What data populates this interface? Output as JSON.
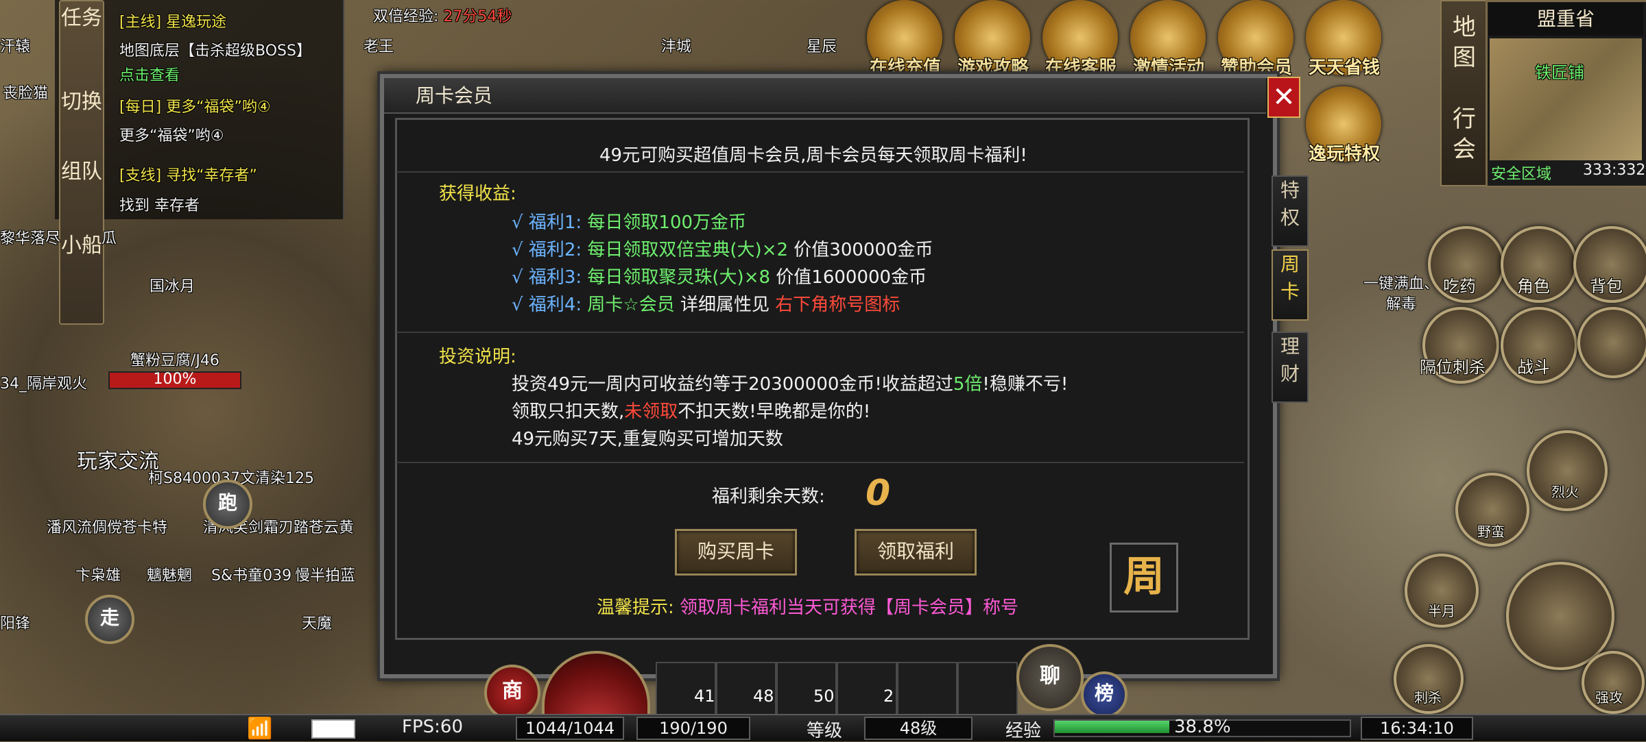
{
  "quest_panel": {
    "side_tabs": [
      "任务",
      "切换",
      "组队",
      "小船"
    ],
    "quests": [
      {
        "tag": "[主线] 星逸玩途",
        "detail": "地图底层【击杀超级BOSS】",
        "link": "点击查看"
      },
      {
        "tag": "[每日] 更多“福袋”哟④",
        "detail": "更多“福袋”哟④"
      },
      {
        "tag": "[支线] 寻找“幸存者”",
        "detail": "找到 幸存者"
      }
    ]
  },
  "top": {
    "double_exp_label": "双倍经验:",
    "double_exp_time": "27分54秒",
    "icons": [
      {
        "name": "在线充值"
      },
      {
        "name": "游戏攻略"
      },
      {
        "name": "在线客服"
      },
      {
        "name": "激情活动"
      },
      {
        "name": "赞助会员"
      },
      {
        "name": "天天省钱"
      },
      {
        "name": "逸玩特权"
      }
    ]
  },
  "map": {
    "tabs": [
      "地图",
      "行会"
    ],
    "region": "盟重省",
    "marker": "铁匠铺",
    "zone": "安全区域",
    "coords": "333:332"
  },
  "dialog": {
    "title": "周卡会员",
    "headline": "49元可购买超值周卡会员,周卡会员每天领取周卡福利!",
    "gain_title": "获得收益:",
    "benefits": [
      {
        "label": "√ 福利1:",
        "text": "每日领取100万金币",
        "extra": ""
      },
      {
        "label": "√ 福利2:",
        "text": "每日领取双倍宝典(大)×2",
        "extra": "价值300000金币"
      },
      {
        "label": "√ 福利3:",
        "text": "每日领取聚灵珠(大)×8",
        "extra": "价值1600000金币"
      },
      {
        "label": "√ 福利4:",
        "text": "周卡☆会员",
        "extra": "详细属性见",
        "hint": "右下角称号图标"
      }
    ],
    "invest_title": "投资说明:",
    "invest_line1_a": "投资49元一周内可收益约等于20300000金币!收益超过",
    "invest_line1_b": "5倍",
    "invest_line1_c": "!稳赚不亏!",
    "invest_line2_a": "领取只扣天数,",
    "invest_line2_b": "未领取",
    "invest_line2_c": "不扣天数!早晚都是你的!",
    "invest_line3": "49元购买7天,重复购买可增加天数",
    "days_label": "福利剩余天数:",
    "days_value": "0",
    "buy_button": "购买周卡",
    "claim_button": "领取福利",
    "week_icon": "周",
    "tip_label": "温馨提示:",
    "tip_text": "领取周卡福利当天可获得【周卡会员】称号",
    "side_tabs": [
      "特权",
      "周卡",
      "理财"
    ]
  },
  "characters": {
    "names": [
      "汗辕",
      "丧脸猫",
      "黎华落尽",
      "瓜",
      "国冰月",
      "蟹粉豆腐/J46",
      "34_隔岸观火",
      "玩家交流",
      "柯S8400037文清染125",
      "潘风流倜傥苍卡特",
      "清风笑剑霜刃踏苍云黄",
      "卞枭雄",
      "魑魅魍",
      "S&书童039",
      "慢半拍蓝",
      "阳锋",
      "天魔",
      "老王",
      "沣城",
      "星辰",
      "一键满血、解毒"
    ],
    "hp_percent": "100%",
    "run_label": "跑",
    "walk_label": "走"
  },
  "skills": [
    {
      "label": "吃药"
    },
    {
      "label": "角色"
    },
    {
      "label": "背包"
    },
    {
      "label": "隔位刺杀"
    },
    {
      "label": "战斗"
    },
    {
      "label": "烈火"
    },
    {
      "label": "野蛮"
    },
    {
      "label": "半月"
    },
    {
      "label": "刺杀"
    },
    {
      "label": "强攻"
    }
  ],
  "bottom": {
    "fps": "FPS:60",
    "hp": "1044/1044",
    "mp": "190/190",
    "level_label": "等级",
    "level_value": "48级",
    "exp_label": "经验",
    "exp_percent": "38.8%",
    "exp_fraction": 0.388,
    "time": "16:34:10",
    "shop_label": "商",
    "chat_label": "聊",
    "rank_label": "榜",
    "items": [
      {
        "count": "41"
      },
      {
        "count": "48"
      },
      {
        "count": "50"
      },
      {
        "count": "2"
      }
    ]
  }
}
